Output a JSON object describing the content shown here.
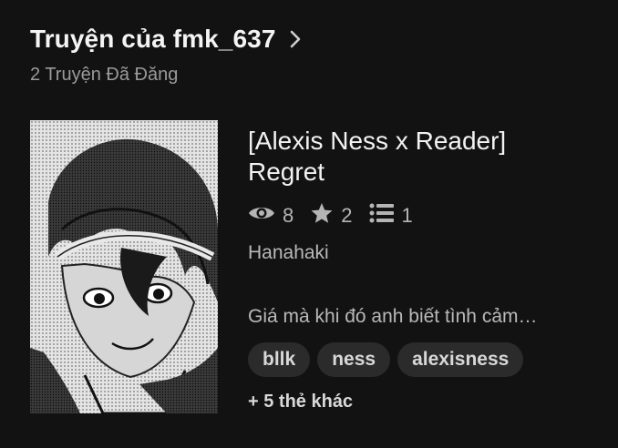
{
  "header": {
    "title": "Truyện của fmk_637",
    "subtitle": "2 Truyện Đã Đăng",
    "chevron_icon": "chevron-right-icon"
  },
  "story": {
    "title_line1": "[Alexis Ness x Reader]",
    "title_line2": "Regret",
    "stats": {
      "views": "8",
      "votes": "2",
      "parts": "1"
    },
    "tagline": "Hanahaki",
    "description": "Giá mà khi đó anh biết tình cảm…",
    "tags": [
      "bllk",
      "ness",
      "alexisness"
    ],
    "more_tags": "+ 5 thẻ khác",
    "cover_alt": "Manga-style cover art of a dark-haired boy"
  }
}
